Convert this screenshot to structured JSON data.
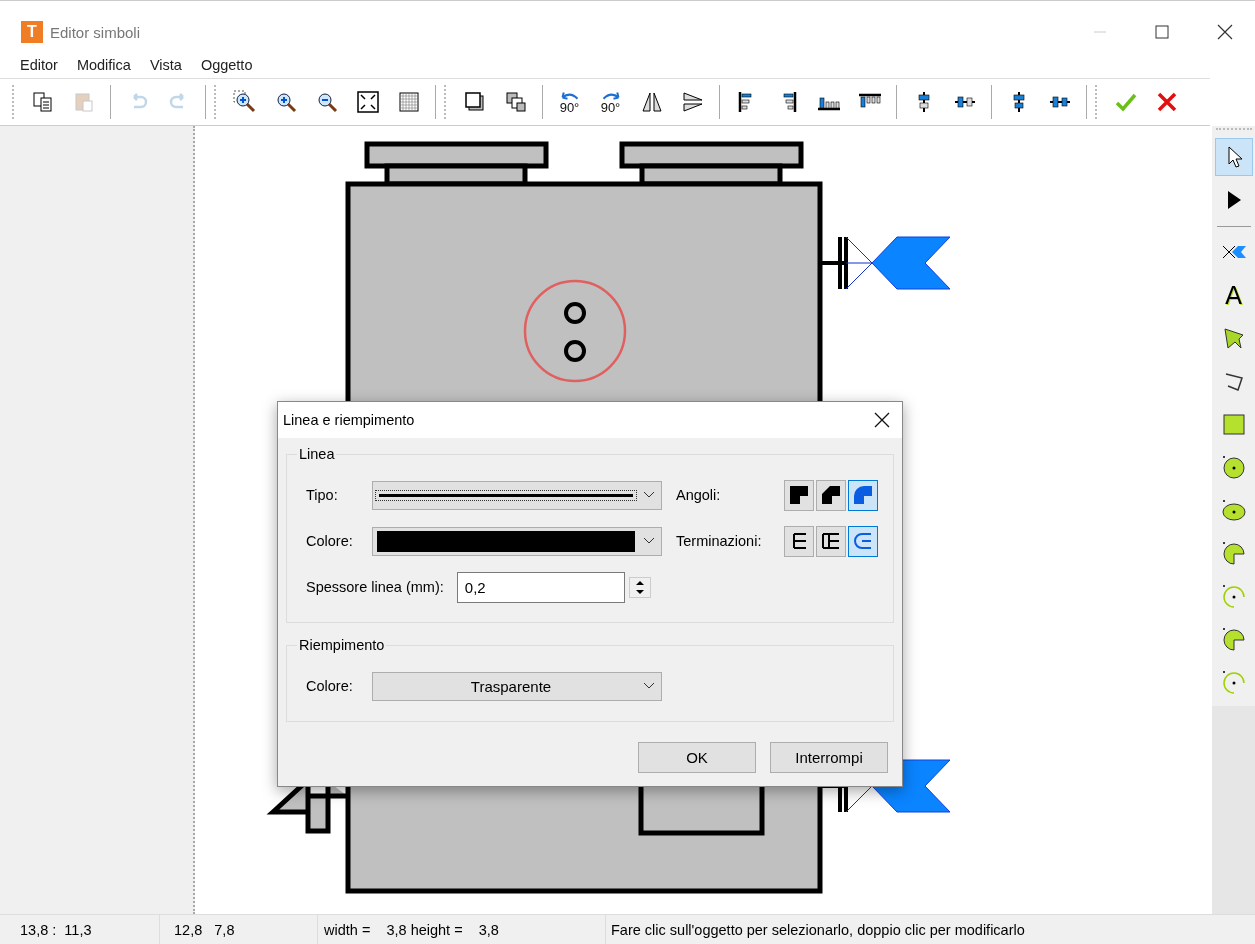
{
  "window": {
    "title": "Editor simboli",
    "app_letter": "T"
  },
  "menu": [
    "Editor",
    "Modifica",
    "Vista",
    "Oggetto"
  ],
  "toolbar": [
    [
      {
        "kind": "copy",
        "disabled": false
      },
      {
        "kind": "paste",
        "disabled": true
      }
    ],
    [
      {
        "kind": "undo",
        "disabled": true
      },
      {
        "kind": "redo",
        "disabled": true
      }
    ],
    [
      {
        "kind": "zoom-area",
        "disabled": false
      },
      {
        "kind": "zoom-in",
        "disabled": false
      },
      {
        "kind": "zoom-out",
        "disabled": false
      },
      {
        "kind": "fit",
        "disabled": false
      },
      {
        "kind": "grid",
        "disabled": false
      }
    ],
    [
      {
        "kind": "front",
        "disabled": false
      },
      {
        "kind": "back",
        "disabled": false
      }
    ],
    [
      {
        "kind": "rotate-left",
        "label": "90°",
        "disabled": false
      },
      {
        "kind": "rotate-right",
        "label": "90°",
        "disabled": false
      },
      {
        "kind": "flip-h",
        "disabled": false
      },
      {
        "kind": "flip-v",
        "disabled": false
      }
    ],
    [
      {
        "kind": "align-left",
        "disabled": false
      },
      {
        "kind": "align-right",
        "disabled": false
      },
      {
        "kind": "align-bottom",
        "disabled": false
      },
      {
        "kind": "align-top",
        "disabled": false
      }
    ],
    [
      {
        "kind": "center-v",
        "disabled": false
      },
      {
        "kind": "center-h",
        "disabled": false
      }
    ],
    [
      {
        "kind": "dist-v",
        "disabled": false
      },
      {
        "kind": "dist-h",
        "disabled": false
      }
    ],
    [
      {
        "kind": "confirm",
        "disabled": false
      },
      {
        "kind": "cancel",
        "disabled": false
      }
    ]
  ],
  "tools": [
    {
      "kind": "pointer",
      "selected": true
    },
    {
      "kind": "arrow",
      "selected": false
    },
    {
      "kind": "connector",
      "selected": false
    },
    {
      "kind": "text",
      "label": "A",
      "selected": false
    },
    {
      "kind": "polygon",
      "selected": false
    },
    {
      "kind": "polyline",
      "selected": false
    },
    {
      "kind": "rectangle",
      "selected": false
    },
    {
      "kind": "circle",
      "selected": false
    },
    {
      "kind": "ellipse",
      "selected": false
    },
    {
      "kind": "pie",
      "selected": false
    },
    {
      "kind": "arc",
      "selected": false
    },
    {
      "kind": "pie",
      "selected": false
    },
    {
      "kind": "arc",
      "selected": false
    }
  ],
  "dialog": {
    "title": "Linea e riempimento",
    "line_group": {
      "title": "Linea",
      "type_label": "Tipo:",
      "color_label": "Colore:",
      "color": "#000000",
      "corners_label": "Angoli:",
      "corners": [
        {
          "kind": "miter",
          "selected": false
        },
        {
          "kind": "bevel",
          "selected": false
        },
        {
          "kind": "round",
          "selected": true
        }
      ],
      "ends_label": "Terminazioni:",
      "ends": [
        {
          "kind": "flat",
          "selected": false
        },
        {
          "kind": "square",
          "selected": false
        },
        {
          "kind": "round",
          "selected": true
        }
      ],
      "width_label": "Spessore linea (mm):",
      "width_value": "0,2"
    },
    "fill_group": {
      "title": "Riempimento",
      "color_label": "Colore:",
      "color_value": "Trasparente"
    },
    "buttons": [
      "OK",
      "Interrompi"
    ]
  },
  "status_bar": [
    "13,8 :  11,3",
    "12,8   7,8",
    "width =    3,8 height =    3,8",
    "Fare clic sull'oggetto per selezionarlo, doppio clic per modificarlo"
  ]
}
